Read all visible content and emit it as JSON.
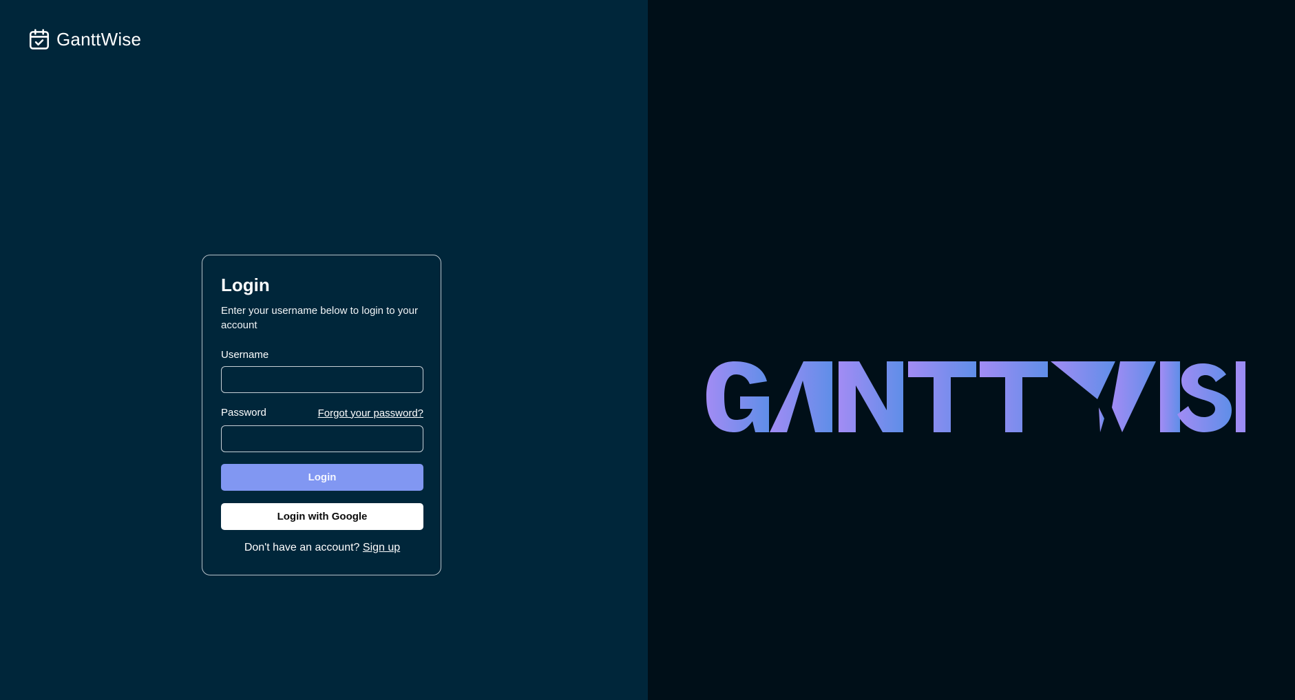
{
  "brand": {
    "name": "GanttWise",
    "icon": "calendar-check-icon"
  },
  "login": {
    "title": "Login",
    "subtitle": "Enter your username below to login to your account",
    "username_label": "Username",
    "username_value": "",
    "password_label": "Password",
    "password_value": "",
    "forgot_password": "Forgot your password?",
    "login_button": "Login",
    "google_button": "Login with Google",
    "signup_prompt": "Don't have an account?",
    "signup_link": "Sign up"
  },
  "hero": {
    "wordmark": "GANTTWISE",
    "gradient_start": "#a28cf4",
    "gradient_end": "#5f8ee8"
  },
  "colors": {
    "left_background": "#00263a",
    "right_background": "#000f18",
    "primary_button": "#8197f2"
  }
}
